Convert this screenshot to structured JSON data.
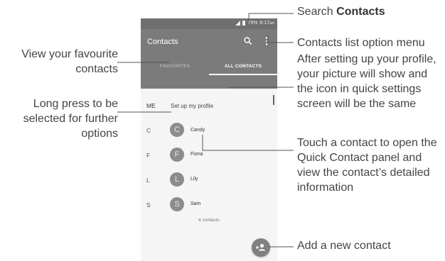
{
  "status_bar": {
    "battery": "79%",
    "time": "8:17",
    "ampm": "am"
  },
  "app_bar": {
    "title": "Contacts"
  },
  "tabs": [
    {
      "label": "FAVOURITES",
      "active": false
    },
    {
      "label": "ALL CONTACTS",
      "active": true
    }
  ],
  "profile": {
    "letter": "ME",
    "text": "Set up my profile"
  },
  "contacts": [
    {
      "letter": "C",
      "initial": "C",
      "name": "Candy"
    },
    {
      "letter": "F",
      "initial": "F",
      "name": "Fiona"
    },
    {
      "letter": "L",
      "initial": "L",
      "name": "Lily"
    },
    {
      "letter": "S",
      "initial": "S",
      "name": "Sam"
    }
  ],
  "contact_count": "4 contacts",
  "callouts": {
    "search_prefix": "Search ",
    "search_bold": "Contacts",
    "menu": "Contacts list option menu",
    "profile": "After setting up your profile, your picture will show and the icon in quick settings screen will be the same",
    "touch": "Touch a contact to open the Quick Contact panel and view the contact’s detailed information",
    "add": "Add a new contact",
    "favourites": "View your favourite contacts",
    "long_press": "Long press to be selected for further options"
  },
  "colors": {
    "app_bar": "#7b7b7b",
    "status_bar": "#6f6f6f",
    "avatar": "#8c8c8c",
    "fab": "#808080",
    "list_bg": "#f5f5f5"
  },
  "icons": [
    "signal-icon",
    "battery-icon",
    "search-icon",
    "more-vert-icon",
    "add-contact-icon"
  ]
}
